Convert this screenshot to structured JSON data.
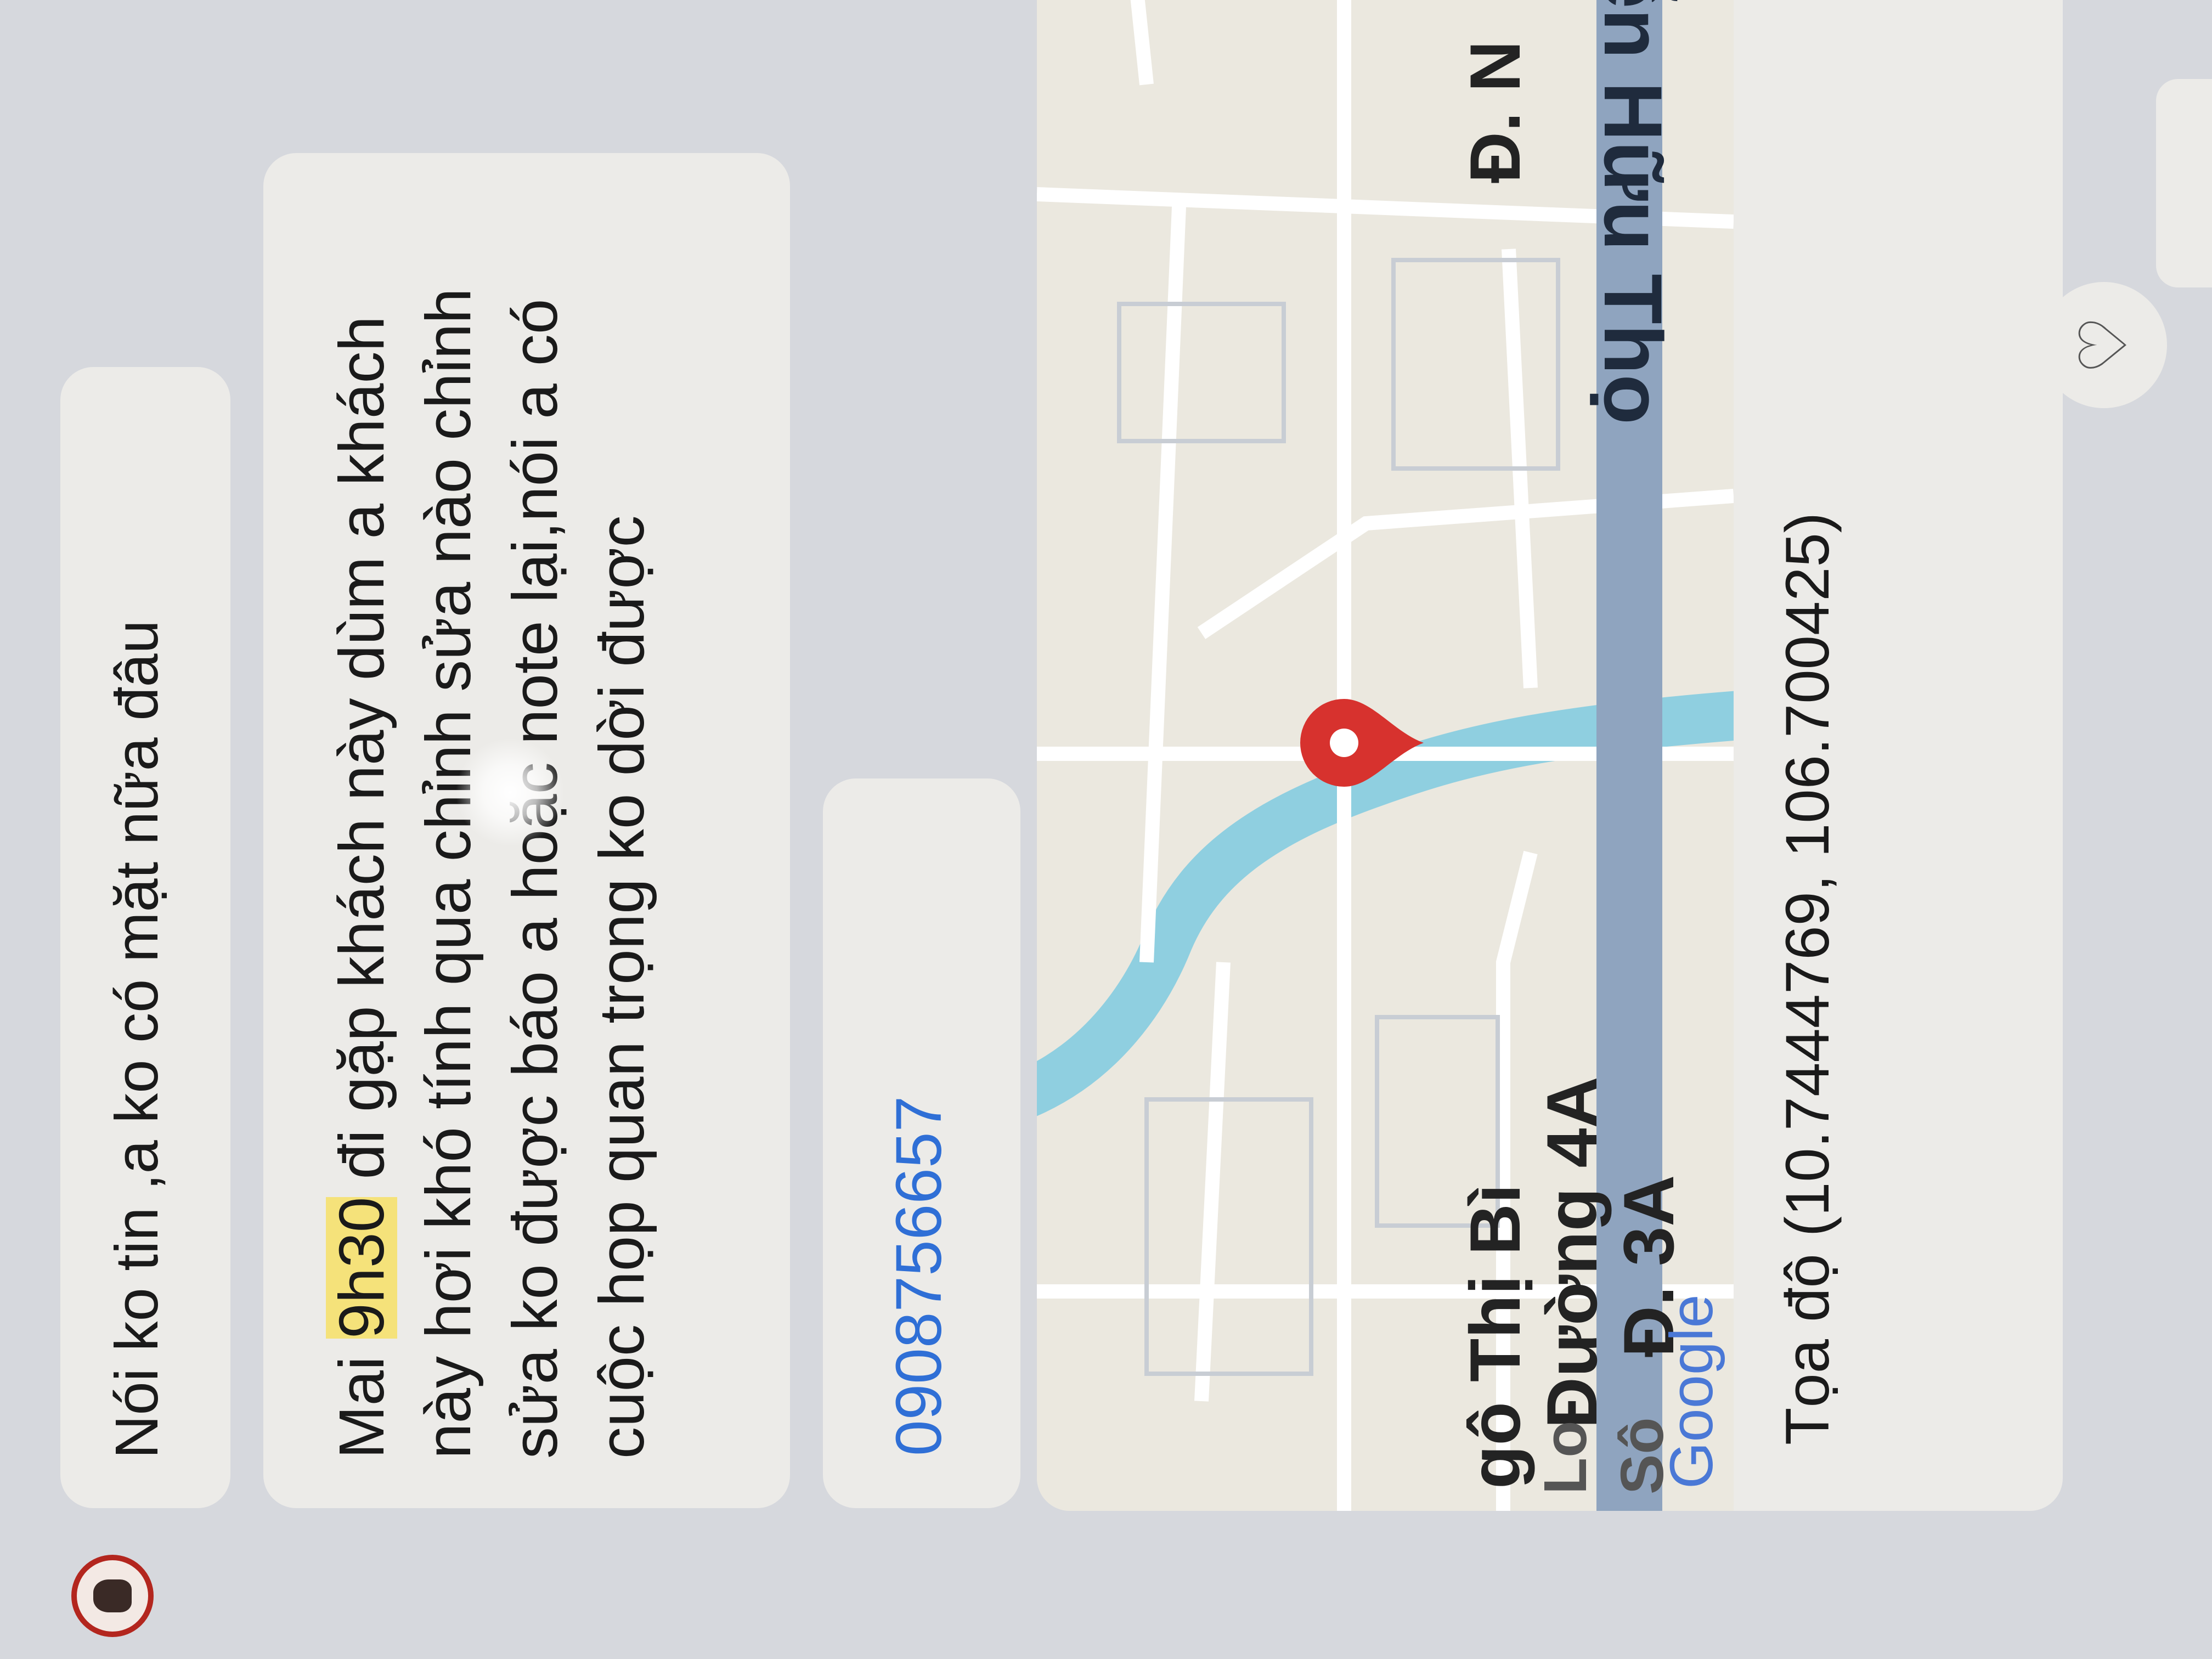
{
  "messages": [
    {
      "text": "Nói ko tin ,a ko có mặt nữa đâu"
    },
    {
      "prefix": "Mai ",
      "highlight": "9h30",
      "rest": " đi gặp khách này dùm a khách này hơi khó tính qua chỉnh sửa nào chỉnh sửa ko được báo a hoặc note lại,nói a có cuộc họp quan trọng ko dời được"
    },
    {
      "phone": "0908756657"
    }
  ],
  "map": {
    "streets": {
      "nguyen_huu_tho": "uyễn Hữu Thọ",
      "d_n": "Đ. N",
      "ngo_thi_bi": "gô Thị Bì",
      "duong_4a": "Đường 4A",
      "d_3a": "Đ. 3A",
      "fragment_1": "Lo",
      "fragment_2": "Sô"
    },
    "logo": "Google",
    "coordinates_text": "Tọa độ (10.7444769, 106.700425)"
  },
  "colors": {
    "bubble": "#ecebe8",
    "highlight": "#f5e27a",
    "link": "#2f6fd6",
    "pin": "#d7322e",
    "river": "#8fcfe0",
    "major_road": "#8fa4bf"
  },
  "icons": {
    "avatar": "avatar-icon",
    "heart": "heart-icon",
    "pin": "map-pin-icon"
  }
}
